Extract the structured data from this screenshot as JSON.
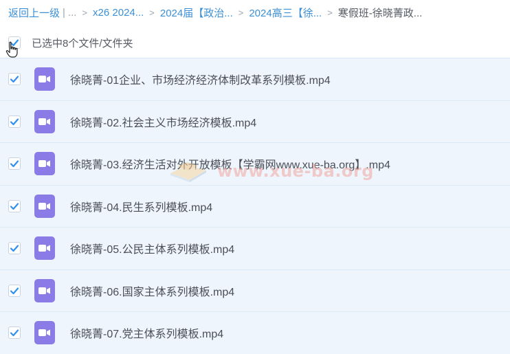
{
  "breadcrumb": {
    "back_label": "返回上一级",
    "pipe": "|",
    "more": "...",
    "items": [
      "x26 2024...",
      "2024届【政治...",
      "2024高三【徐...",
      "寒假班-徐晓菁政..."
    ]
  },
  "selection": {
    "label": "已选中8个文件/文件夹",
    "checked": true
  },
  "files": [
    {
      "name": "徐晓菁-01企业、市场经济经济体制改革系列模板.mp4",
      "checked": true
    },
    {
      "name": "徐晓菁-02.社会主义市场经济模板.mp4",
      "checked": true
    },
    {
      "name": "徐晓菁-03.经济生活对外开放模板【学霸网www.xue-ba.org】.mp4",
      "checked": true
    },
    {
      "name": "徐晓菁-04.民生系列模板.mp4",
      "checked": true
    },
    {
      "name": "徐晓菁-05.公民主体系列模板.mp4",
      "checked": true
    },
    {
      "name": "徐晓菁-06.国家主体系列模板.mp4",
      "checked": true
    },
    {
      "name": "徐晓菁-07.党主体系列模板.mp4",
      "checked": true
    }
  ],
  "watermark": {
    "text": "www.xue-ba.org"
  },
  "colors": {
    "link": "#3b8fd6",
    "check": "#2f8ff0",
    "row_bg": "#eef5fc",
    "video_icon": "#8a7be6"
  },
  "icons": {
    "checkbox": "checkmark-icon",
    "file": "video-file-icon",
    "cursor": "hand-cursor-icon"
  }
}
